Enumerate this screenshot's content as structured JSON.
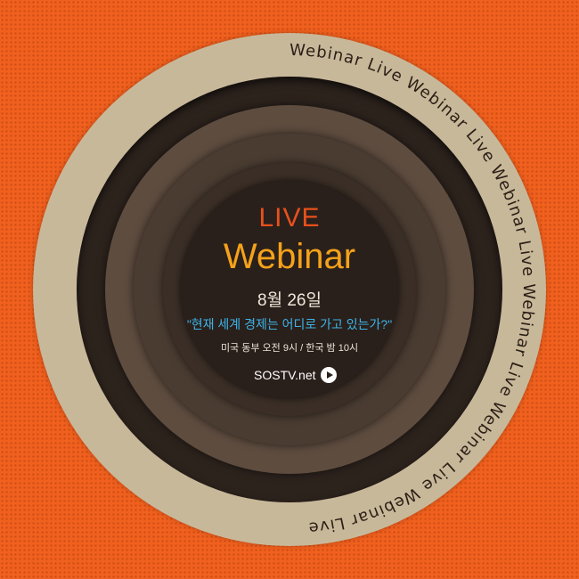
{
  "ring_text": "Webinar Live    Webinar Live    Webinar Live    Webinar Live    Webinar Live    Webinar Live    ",
  "headline": {
    "live": "LIVE",
    "webinar": "Webinar"
  },
  "date": "8월 26일",
  "question": "\"현재 세계 경제는 어디로 가고 있는가?\"",
  "time": "미국 동부 오전 9시  / 한국 밤 10시",
  "site": {
    "label": "SOSTV.net",
    "icon": "play-icon"
  },
  "colors": {
    "background": "#f0601e",
    "ring_outer": "#c8b89a",
    "live": "#e8501c",
    "webinar": "#f5a21a",
    "question": "#3cb4ea"
  }
}
